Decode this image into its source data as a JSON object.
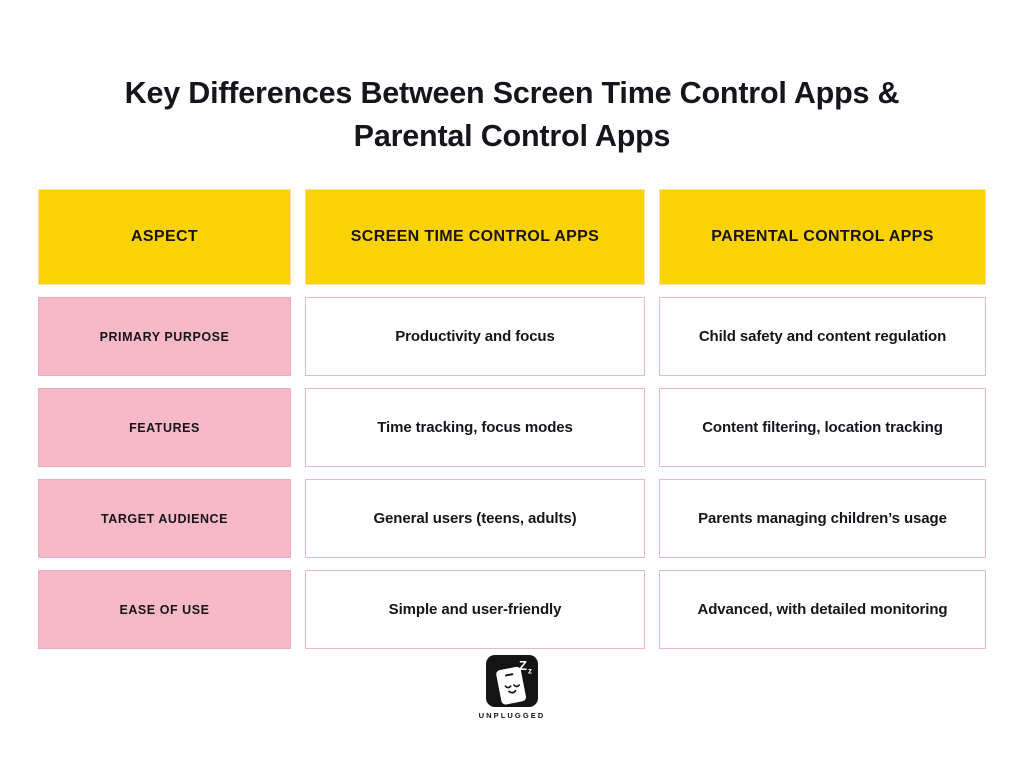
{
  "title": {
    "line1": "Key Differences Between Screen Time Control Apps &",
    "line2": "Parental Control Apps"
  },
  "colors": {
    "header_yellow": "#fbd204",
    "label_pink": "#f7b8c7",
    "value_border_pink": "#efb8c6",
    "text_dark": "#16151a",
    "logo_black": "#141414",
    "page_background": "#ffffff"
  },
  "table": {
    "headers": {
      "aspect": "ASPECT",
      "screen_time": "SCREEN TIME CONTROL APPS",
      "parental": "PARENTAL CONTROL APPS"
    },
    "rows": [
      {
        "aspect": "PRIMARY PURPOSE",
        "screen_time": "Productivity and focus",
        "parental": "Child safety and content regulation"
      },
      {
        "aspect": "FEATURES",
        "screen_time": "Time tracking, focus modes",
        "parental": "Content filtering, location tracking"
      },
      {
        "aspect": "TARGET AUDIENCE",
        "screen_time": "General users (teens, adults)",
        "parental": "Parents managing children’s usage"
      },
      {
        "aspect": "EASE OF USE",
        "screen_time": "Simple and user-friendly",
        "parental": "Advanced, with detailed monitoring"
      }
    ]
  },
  "logo": {
    "wordmark": "UNPLUGGED",
    "icon": "sleeping-phone-icon",
    "z_large": "Z",
    "z_small": "z"
  }
}
